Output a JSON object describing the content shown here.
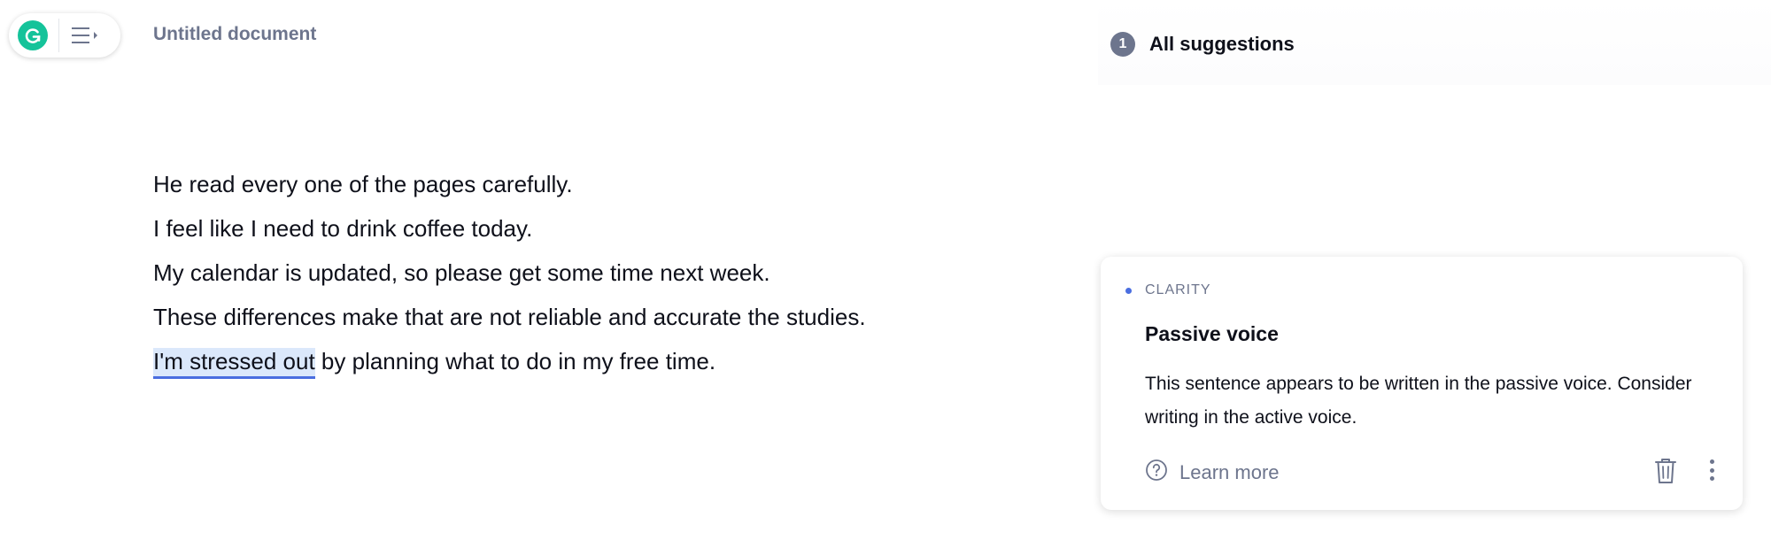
{
  "app": {
    "logo_icon": "grammarly-g-icon",
    "menu_icon": "hamburger-menu-icon",
    "brand_color": "#15c39a"
  },
  "document": {
    "title": "Untitled document",
    "lines": [
      "He read every one of the pages carefully.",
      "I feel like I need to drink coffee today.",
      "My calendar is updated, so please get some time next week.",
      "These differences make that are not reliable and accurate the studies."
    ],
    "flagged_line": {
      "highlight": "I'm stressed out",
      "rest": " by planning what to do in my free time."
    }
  },
  "suggestions": {
    "count": "1",
    "header": "All suggestions",
    "card": {
      "category": "CLARITY",
      "category_color": "#4a6ee0",
      "title": "Passive voice",
      "description": "This sentence appears to be written in the passive voice. Consider writing in the active voice.",
      "learn_more": "Learn more",
      "learn_more_icon": "question-circle-icon",
      "dismiss_icon": "trash-icon",
      "more_icon": "more-vertical-icon"
    }
  }
}
